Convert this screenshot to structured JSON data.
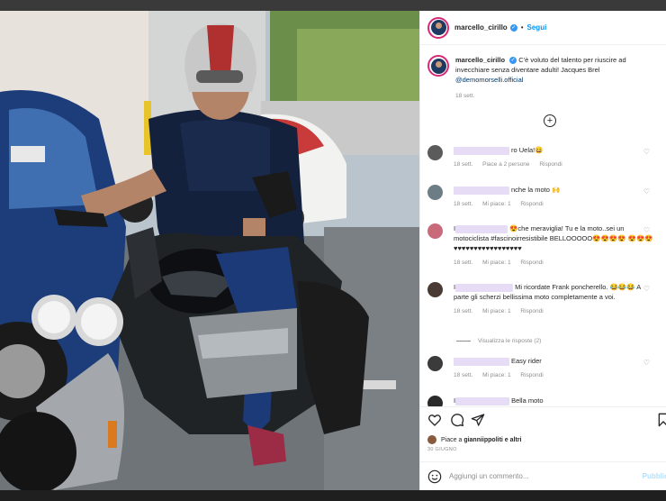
{
  "post": {
    "username": "marcello_cirillo",
    "follow_label": "Segui",
    "separator": "•"
  },
  "caption": {
    "username": "marcello_cirillo",
    "text": "C'è voluto del talento per riuscire ad invecchiare senza diventare adulti! Jacques Brel",
    "mention": "@demomorselli.official",
    "time": "18 sett."
  },
  "comments": [
    {
      "text": "ro Uela!😄",
      "time": "18 sett.",
      "likes": "Piace a 2 persone",
      "reply": "Rispondi"
    },
    {
      "text": "nche la moto 🙌",
      "time": "18 sett.",
      "likes": "Mi piace: 1",
      "reply": "Rispondi"
    },
    {
      "prefix": "I",
      "text": "😍che meraviglia! Tu e la moto..sei un motociclista #fascinoirresistibile BELLOOOOO😍😍😍😍 😍😍😍 ♥♥♥♥♥♥♥♥♥♥♥♥♥♥♥♥♥",
      "time": "18 sett.",
      "likes": "Mi piace: 1",
      "reply": "Rispondi"
    },
    {
      "prefix": "I",
      "text": "Mi ricordate Frank poncherello. 😂😂😂 A parte gli scherzi bellissima moto completamente a voi.",
      "time": "18 sett.",
      "likes": "Mi piace: 1",
      "reply": "Rispondi"
    },
    {
      "text": "Easy rider",
      "time": "18 sett.",
      "likes": "Mi piace: 1",
      "reply": "Rispondi"
    },
    {
      "prefix": "I",
      "text": "Bella moto",
      "time": "",
      "likes": "",
      "reply": ""
    }
  ],
  "replies_label": "Visualizza le risposte (2)",
  "likes_line": {
    "prefix": "Piace a",
    "names": "gianniippoliti e altri"
  },
  "date": "30 GIUGNO",
  "comment_box": {
    "placeholder": "Aggiungi un commento...",
    "publish_label": "Pubblica"
  },
  "icons": {
    "like": "heart-icon",
    "comment": "comment-bubble-icon",
    "share": "paper-plane-icon",
    "save": "bookmark-icon",
    "emoji": "smiley-icon",
    "add": "plus-circle-icon"
  },
  "colors": {
    "link": "#00376b",
    "follow": "#0095f6",
    "muted": "#8e8e8e",
    "text": "#262626",
    "verified": "#3897f0"
  }
}
